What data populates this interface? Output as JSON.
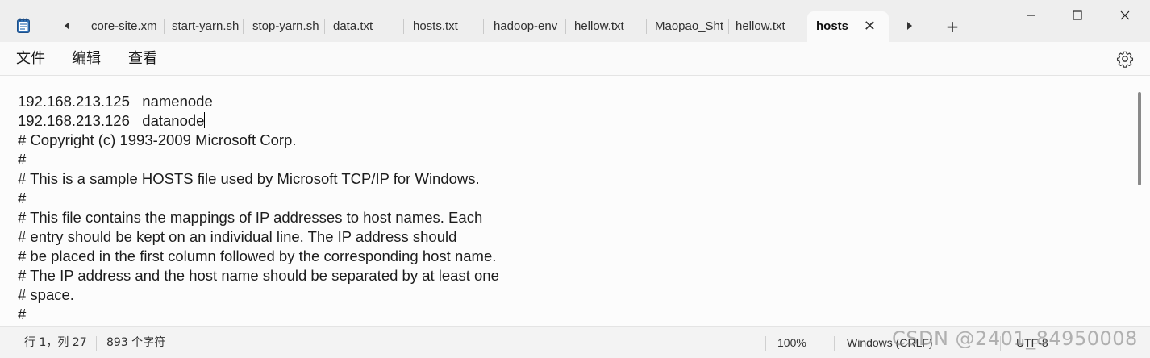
{
  "titlebar": {
    "app_icon": "notepad-icon",
    "nav_left_icon": "caret-left-icon",
    "nav_right_icon": "caret-right-icon",
    "new_tab_label": "+",
    "tabs": [
      {
        "label": "core-site.xm"
      },
      {
        "label": "start-yarn.sh"
      },
      {
        "label": "stop-yarn.sh"
      },
      {
        "label": "data.txt"
      },
      {
        "label": "hosts.txt"
      },
      {
        "label": "hadoop-env"
      },
      {
        "label": "hellow.txt"
      },
      {
        "label": "Maopao_Sht"
      },
      {
        "label": "hellow.txt"
      },
      {
        "label": "hosts",
        "active": true
      }
    ],
    "close_tab_glyph": "✕",
    "window_controls": {
      "minimize": "—",
      "maximize": "☐",
      "close": "✕"
    }
  },
  "menubar": {
    "file": "文件",
    "edit": "编辑",
    "view": "查看",
    "settings_icon": "gear-icon"
  },
  "editor": {
    "lines": [
      "192.168.213.125   namenode",
      "192.168.213.126   datanode",
      "# Copyright (c) 1993-2009 Microsoft Corp.",
      "#",
      "# This is a sample HOSTS file used by Microsoft TCP/IP for Windows.",
      "#",
      "# This file contains the mappings of IP addresses to host names. Each",
      "# entry should be kept on an individual line. The IP address should",
      "# be placed in the first column followed by the corresponding host name.",
      "# The IP address and the host name should be separated by at least one",
      "# space.",
      "#"
    ]
  },
  "statusbar": {
    "position": "行 1，列 27",
    "char_count": "893 个字符",
    "zoom": "100%",
    "line_ending": "Windows (CRLF)",
    "encoding": "UTF-8"
  },
  "watermark": "CSDN @2401_84950008"
}
